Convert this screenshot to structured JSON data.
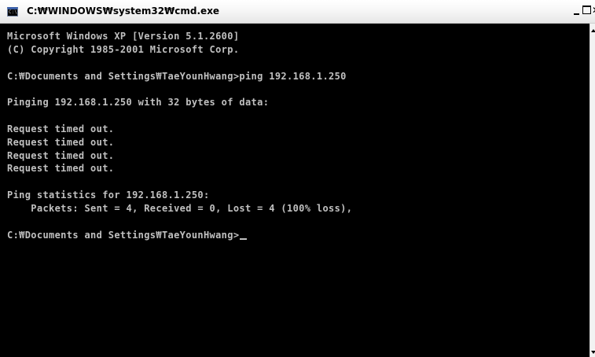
{
  "window": {
    "title": "C:₩WINDOWS₩system32₩cmd.exe",
    "icon": "cmd-icon",
    "icon_text": "C:\\",
    "colors": {
      "background": "#000000",
      "text": "#c0c0c0"
    }
  },
  "console": {
    "lines": [
      "Microsoft Windows XP [Version 5.1.2600]",
      "(C) Copyright 1985-2001 Microsoft Corp.",
      "",
      "C:₩Documents and Settings₩TaeYounHwang>ping 192.168.1.250",
      "",
      "Pinging 192.168.1.250 with 32 bytes of data:",
      "",
      "Request timed out.",
      "Request timed out.",
      "Request timed out.",
      "Request timed out.",
      "",
      "Ping statistics for 192.168.1.250:",
      "    Packets: Sent = 4, Received = 0, Lost = 4 (100% loss),",
      "",
      "C:₩Documents and Settings₩TaeYounHwang>"
    ]
  }
}
